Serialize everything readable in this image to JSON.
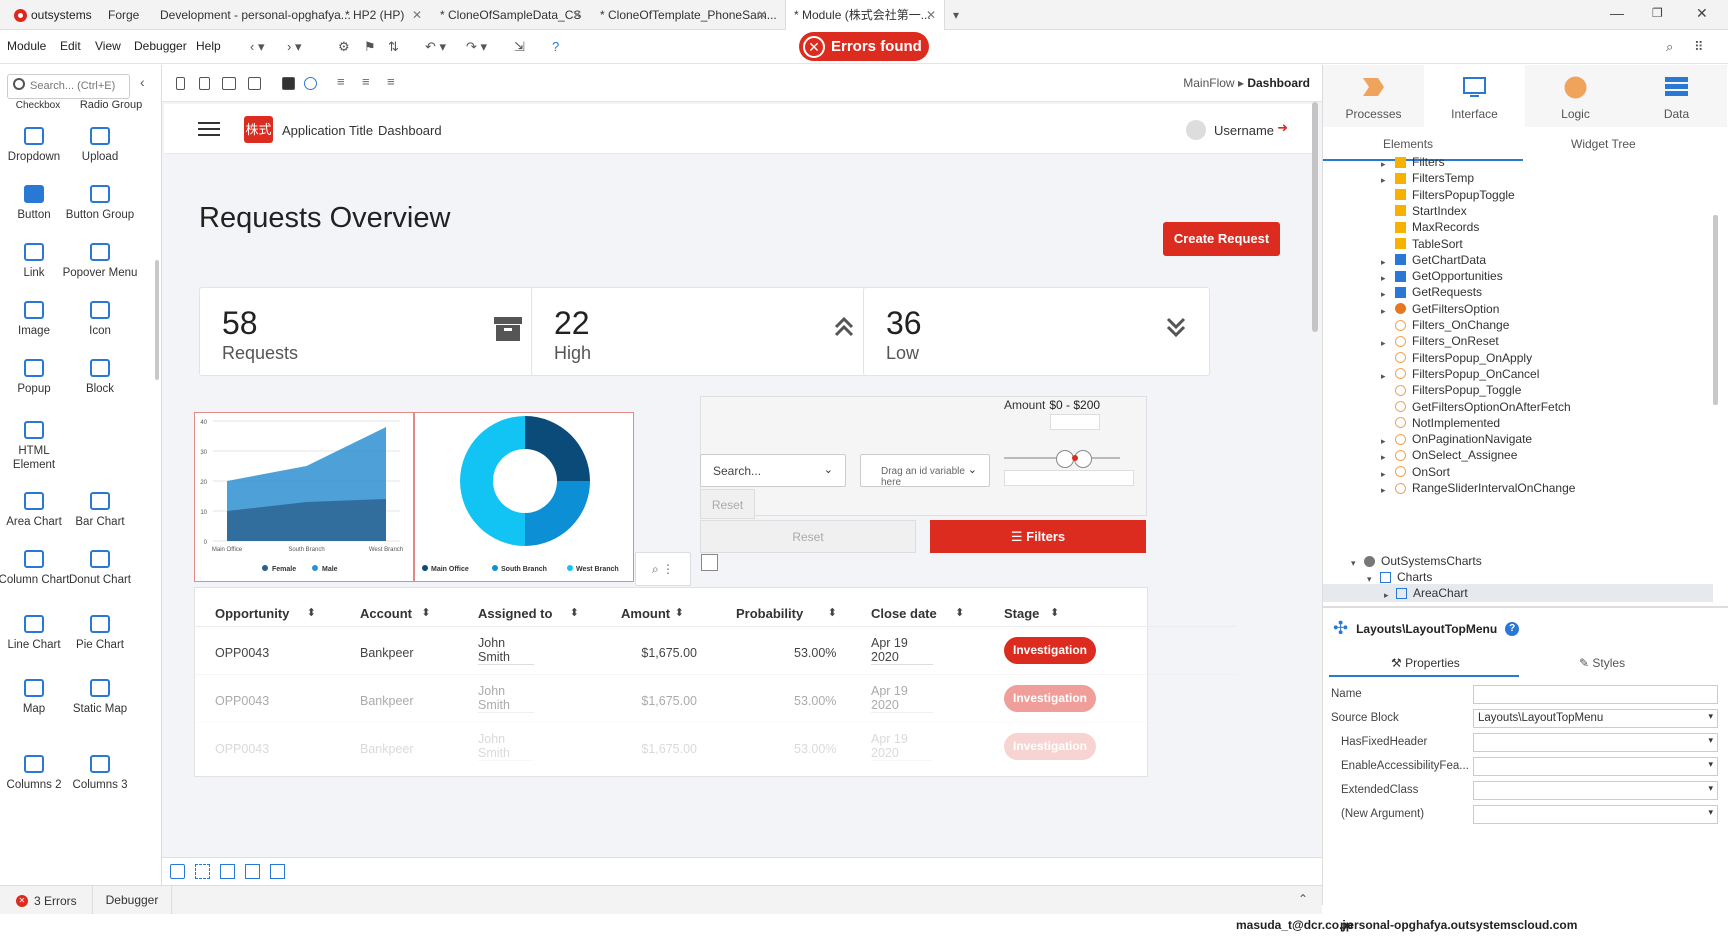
{
  "tabs": {
    "logo": "outsystems",
    "items": [
      "Forge",
      "Development - personal-opghafya...",
      "* HP2 (HP)",
      "* CloneOfSampleData_CS",
      "* CloneOfTemplate_PhoneSam...",
      "* Module (株式会社第一..."
    ]
  },
  "menu": {
    "items": [
      "Module",
      "Edit",
      "View",
      "Debugger",
      "Help"
    ],
    "error_badge": "Errors found"
  },
  "toolbox": {
    "search_placeholder": "Search... (Ctrl+E)",
    "partial_top": [
      "Checkbox",
      "Radio Group"
    ],
    "widgets": [
      {
        "label": "Dropdown",
        "icon": "dropdown-icon"
      },
      {
        "label": "Upload",
        "icon": "upload-icon"
      },
      {
        "label": "Button",
        "icon": "button-icon"
      },
      {
        "label": "Button Group",
        "icon": "button-group-icon"
      },
      {
        "label": "Link",
        "icon": "link-icon"
      },
      {
        "label": "Popover Menu",
        "icon": "popover-menu-icon"
      },
      {
        "label": "Image",
        "icon": "image-icon"
      },
      {
        "label": "Icon",
        "icon": "flag-icon"
      },
      {
        "label": "Popup",
        "icon": "popup-icon"
      },
      {
        "label": "Block",
        "icon": "block-icon"
      },
      {
        "label": "HTML Element",
        "icon": "html-element-icon"
      },
      {
        "label": "Area Chart",
        "icon": "area-chart-icon"
      },
      {
        "label": "Bar Chart",
        "icon": "bar-chart-icon"
      },
      {
        "label": "Column Chart",
        "icon": "column-chart-icon"
      },
      {
        "label": "Donut Chart",
        "icon": "donut-chart-icon"
      },
      {
        "label": "Line Chart",
        "icon": "line-chart-icon"
      },
      {
        "label": "Pie Chart",
        "icon": "pie-chart-icon"
      },
      {
        "label": "Map",
        "icon": "map-icon"
      },
      {
        "label": "Static Map",
        "icon": "static-map-icon"
      },
      {
        "label": "Columns 2",
        "icon": "columns-2-icon"
      },
      {
        "label": "Columns 3",
        "icon": "columns-3-icon"
      }
    ]
  },
  "breadcrumb": {
    "flow": "MainFlow",
    "screen": "Dashboard"
  },
  "app": {
    "logo_text": "株式",
    "title": "Application Title",
    "menu": "Dashboard",
    "username": "Username",
    "page_title": "Requests Overview",
    "create_button": "Create Request",
    "cards": [
      {
        "number": "58",
        "label": "Requests",
        "icon": "archive-icon"
      },
      {
        "number": "22",
        "label": "High",
        "icon": "double-chevron-up-icon"
      },
      {
        "number": "36",
        "label": "Low",
        "icon": "double-chevron-down-icon"
      }
    ],
    "filters": {
      "amount_label": "Amount",
      "amount_value": "$0 - $200",
      "search_placeholder": "Search...",
      "dropdown_placeholder": "Drag an id variable here",
      "reset_small": "Reset",
      "reset_big": "Reset",
      "filters_button": "Filters"
    },
    "table": {
      "headers": [
        "Opportunity",
        "Account",
        "Assigned to",
        "Amount",
        "Probability",
        "Close date",
        "Stage"
      ],
      "rows": [
        {
          "opportunity": "OPP0043",
          "account": "Bankpeer",
          "assigned": "John Smith",
          "assigned_sub": "-",
          "amount": "$1,675.00",
          "probability": "53.00%",
          "close": "Apr 19 2020",
          "close_sub": "-",
          "stage": "Investigation"
        },
        {
          "opportunity": "OPP0043",
          "account": "Bankpeer",
          "assigned": "John Smith",
          "assigned_sub": "-",
          "amount": "$1,675.00",
          "probability": "53.00%",
          "close": "Apr 19 2020",
          "close_sub": "-",
          "stage": "Investigation"
        },
        {
          "opportunity": "OPP0043",
          "account": "Bankpeer",
          "assigned": "John Smith",
          "assigned_sub": "",
          "amount": "$1,675.00",
          "probability": "53.00%",
          "close": "Apr 19 2020",
          "close_sub": "",
          "stage": "Investigation"
        }
      ]
    }
  },
  "chart_data": [
    {
      "type": "area",
      "categories": [
        "Main Office",
        "South Branch",
        "West Branch"
      ],
      "series": [
        {
          "name": "Female",
          "values": [
            10,
            13,
            14
          ],
          "color": "#2a5d8a"
        },
        {
          "name": "Male",
          "values": [
            20,
            25,
            38
          ],
          "color": "#2f8fd1"
        }
      ],
      "ylim": [
        0,
        40
      ],
      "yticks": [
        0,
        10,
        20,
        30,
        40
      ],
      "legend": "bottom"
    },
    {
      "type": "pie",
      "donut": true,
      "categories": [
        "Main Office",
        "South Branch",
        "West Branch"
      ],
      "values": [
        25,
        25,
        50
      ],
      "colors": [
        "#0b4b7a",
        "#0d8fd6",
        "#12c4f4"
      ],
      "legend": "bottom"
    }
  ],
  "right_panel": {
    "tabs": [
      {
        "label": "Processes",
        "icon": "processes-icon"
      },
      {
        "label": "Interface",
        "icon": "interface-icon"
      },
      {
        "label": "Logic",
        "icon": "logic-icon"
      },
      {
        "label": "Data",
        "icon": "data-icon"
      }
    ],
    "subtabs": [
      "Elements",
      "Widget Tree"
    ],
    "tree": [
      {
        "label": "Filters",
        "icon": "variable-icon",
        "arrow": true
      },
      {
        "label": "FiltersTemp",
        "icon": "variable-icon",
        "arrow": true
      },
      {
        "label": "FiltersPopupToggle",
        "icon": "variable-icon",
        "arrow": false
      },
      {
        "label": "StartIndex",
        "icon": "variable-icon",
        "arrow": false
      },
      {
        "label": "MaxRecords",
        "icon": "variable-icon",
        "arrow": false
      },
      {
        "label": "TableSort",
        "icon": "variable-icon",
        "arrow": false
      },
      {
        "label": "GetChartData",
        "icon": "aggregate-icon",
        "arrow": true
      },
      {
        "label": "GetOpportunities",
        "icon": "aggregate-icon",
        "arrow": true
      },
      {
        "label": "GetRequests",
        "icon": "aggregate-icon",
        "arrow": true
      },
      {
        "label": "GetFiltersOption",
        "icon": "data-action-icon",
        "arrow": true
      },
      {
        "label": "Filters_OnChange",
        "icon": "client-action-icon",
        "arrow": false
      },
      {
        "label": "Filters_OnReset",
        "icon": "client-action-icon",
        "arrow": true
      },
      {
        "label": "FiltersPopup_OnApply",
        "icon": "client-action-icon",
        "arrow": false
      },
      {
        "label": "FiltersPopup_OnCancel",
        "icon": "client-action-icon",
        "arrow": true
      },
      {
        "label": "FiltersPopup_Toggle",
        "icon": "client-action-icon",
        "arrow": false
      },
      {
        "label": "GetFiltersOptionOnAfterFetch",
        "icon": "client-action-icon",
        "arrow": false
      },
      {
        "label": "NotImplemented",
        "icon": "client-action-icon",
        "arrow": false
      },
      {
        "label": "OnPaginationNavigate",
        "icon": "client-action-icon",
        "arrow": true
      },
      {
        "label": "OnSelect_Assignee",
        "icon": "client-action-icon",
        "arrow": true
      },
      {
        "label": "OnSort",
        "icon": "client-action-icon",
        "arrow": true
      },
      {
        "label": "RangeSliderIntervalOnChange",
        "icon": "client-action-icon",
        "arrow": true
      }
    ],
    "tree_group": "OutSystemsCharts",
    "tree_folder": "Charts",
    "tree_selected": "AreaChart",
    "props_title": "Layouts\\LayoutTopMenu",
    "props_tabs": [
      "Properties",
      "Styles"
    ],
    "props": [
      {
        "name": "Name",
        "value": ""
      },
      {
        "name": "Source Block",
        "value": "Layouts\\LayoutTopMenu"
      },
      {
        "name": "HasFixedHeader",
        "value": ""
      },
      {
        "name": "EnableAccessibilityFea...",
        "value": ""
      },
      {
        "name": "ExtendedClass",
        "value": ""
      },
      {
        "name": "(New Argument)",
        "value": ""
      }
    ]
  },
  "status": {
    "errors": "3 Errors",
    "debugger": "Debugger",
    "user": "masuda_t@dcr.co.jp",
    "server": "personal-opghafya.outsystemscloud.com"
  }
}
